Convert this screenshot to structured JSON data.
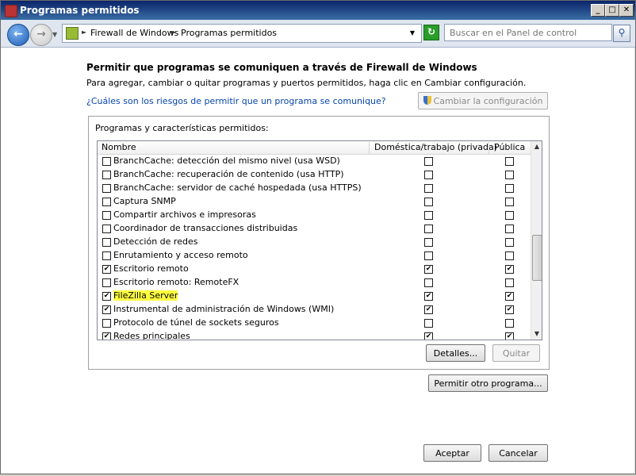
{
  "window": {
    "title": "Programas permitidos",
    "controls": [
      "_",
      "□",
      "✕"
    ]
  },
  "address": {
    "crumbs": [
      "Firewall de Windows",
      "Programas permitidos"
    ],
    "search_placeholder": "Buscar en el Panel de control"
  },
  "page": {
    "heading": "Permitir que programas se comuniquen a través de Firewall de Windows",
    "subtitle": "Para agregar, cambiar o quitar programas y puertos permitidos, haga clic en Cambiar configuración.",
    "risk_link": "¿Cuáles son los riesgos de permitir que un programa se comunique?",
    "change_settings_label": "Cambiar la configuración"
  },
  "programs": {
    "group_label": "Programas y características permitidos:",
    "columns": {
      "name": "Nombre",
      "private": "Doméstica/trabajo (privada)",
      "public": "Pública"
    },
    "rows": [
      {
        "name": "BranchCache: detección del mismo nivel (usa WSD)",
        "enabled": false,
        "private": false,
        "public": false
      },
      {
        "name": "BranchCache: recuperación de contenido (usa HTTP)",
        "enabled": false,
        "private": false,
        "public": false
      },
      {
        "name": "BranchCache: servidor de caché hospedada (usa HTTPS)",
        "enabled": false,
        "private": false,
        "public": false
      },
      {
        "name": "Captura SNMP",
        "enabled": false,
        "private": false,
        "public": false
      },
      {
        "name": "Compartir archivos e impresoras",
        "enabled": false,
        "private": false,
        "public": false
      },
      {
        "name": "Coordinador de transacciones distribuidas",
        "enabled": false,
        "private": false,
        "public": false
      },
      {
        "name": "Detección de redes",
        "enabled": false,
        "private": false,
        "public": false
      },
      {
        "name": "Enrutamiento y acceso remoto",
        "enabled": false,
        "private": false,
        "public": false
      },
      {
        "name": "Escritorio remoto",
        "enabled": true,
        "private": true,
        "public": true
      },
      {
        "name": "Escritorio remoto: RemoteFX",
        "enabled": false,
        "private": false,
        "public": false
      },
      {
        "name": "FileZilla Server",
        "enabled": true,
        "private": true,
        "public": true,
        "highlighted": true
      },
      {
        "name": "Instrumental de administración de Windows (WMI)",
        "enabled": true,
        "private": true,
        "public": true
      },
      {
        "name": "Protocolo de túnel de sockets seguros",
        "enabled": false,
        "private": false,
        "public": false
      },
      {
        "name": "Redes principales",
        "enabled": true,
        "private": true,
        "public": true
      }
    ],
    "details_label": "Detalles...",
    "remove_label": "Quitar"
  },
  "allow_other_label": "Permitir otro programa...",
  "footer": {
    "ok_label": "Aceptar",
    "cancel_label": "Cancelar"
  },
  "colors": {
    "highlight": "#ffff40",
    "title_bar": "#0a246a",
    "link": "#0645ad"
  }
}
